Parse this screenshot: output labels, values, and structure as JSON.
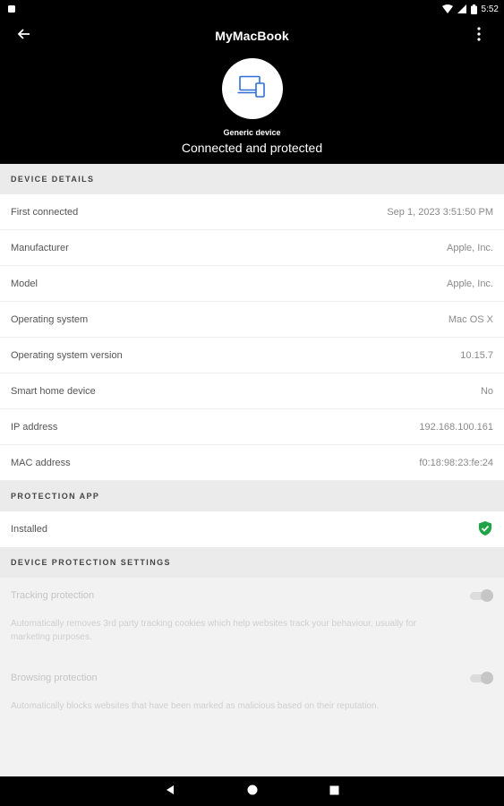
{
  "status_bar": {
    "time": "5:52"
  },
  "header": {
    "title": "MyMacBook",
    "device_type": "Generic device",
    "status": "Connected and protected"
  },
  "device_details": {
    "heading": "DEVICE DETAILS",
    "rows": [
      {
        "label": "First connected",
        "value": "Sep 1, 2023 3:51:50 PM"
      },
      {
        "label": "Manufacturer",
        "value": "Apple, Inc."
      },
      {
        "label": "Model",
        "value": "Apple, Inc."
      },
      {
        "label": "Operating system",
        "value": "Mac OS X"
      },
      {
        "label": "Operating system version",
        "value": "10.15.7"
      },
      {
        "label": "Smart home device",
        "value": "No"
      },
      {
        "label": "IP address",
        "value": "192.168.100.161"
      },
      {
        "label": "MAC address",
        "value": "f0:18:98:23:fe:24"
      }
    ]
  },
  "protection_app": {
    "heading": "PROTECTION APP",
    "installed_label": "Installed",
    "shield_color": "#1ea446"
  },
  "protection_settings": {
    "heading": "DEVICE PROTECTION SETTINGS",
    "items": [
      {
        "title": "Tracking protection",
        "description": "Automatically removes 3rd party tracking cookies which help websites track your behaviour, usually for marketing purposes.",
        "enabled": true
      },
      {
        "title": "Browsing protection",
        "description": "Automatically blocks websites that have been marked as malicious based on their reputation.",
        "enabled": true
      }
    ]
  },
  "icons": {
    "back": "arrow-left-icon",
    "menu": "more-vert-icon",
    "device": "laptop-phone-icon",
    "shield": "shield-check-icon"
  }
}
